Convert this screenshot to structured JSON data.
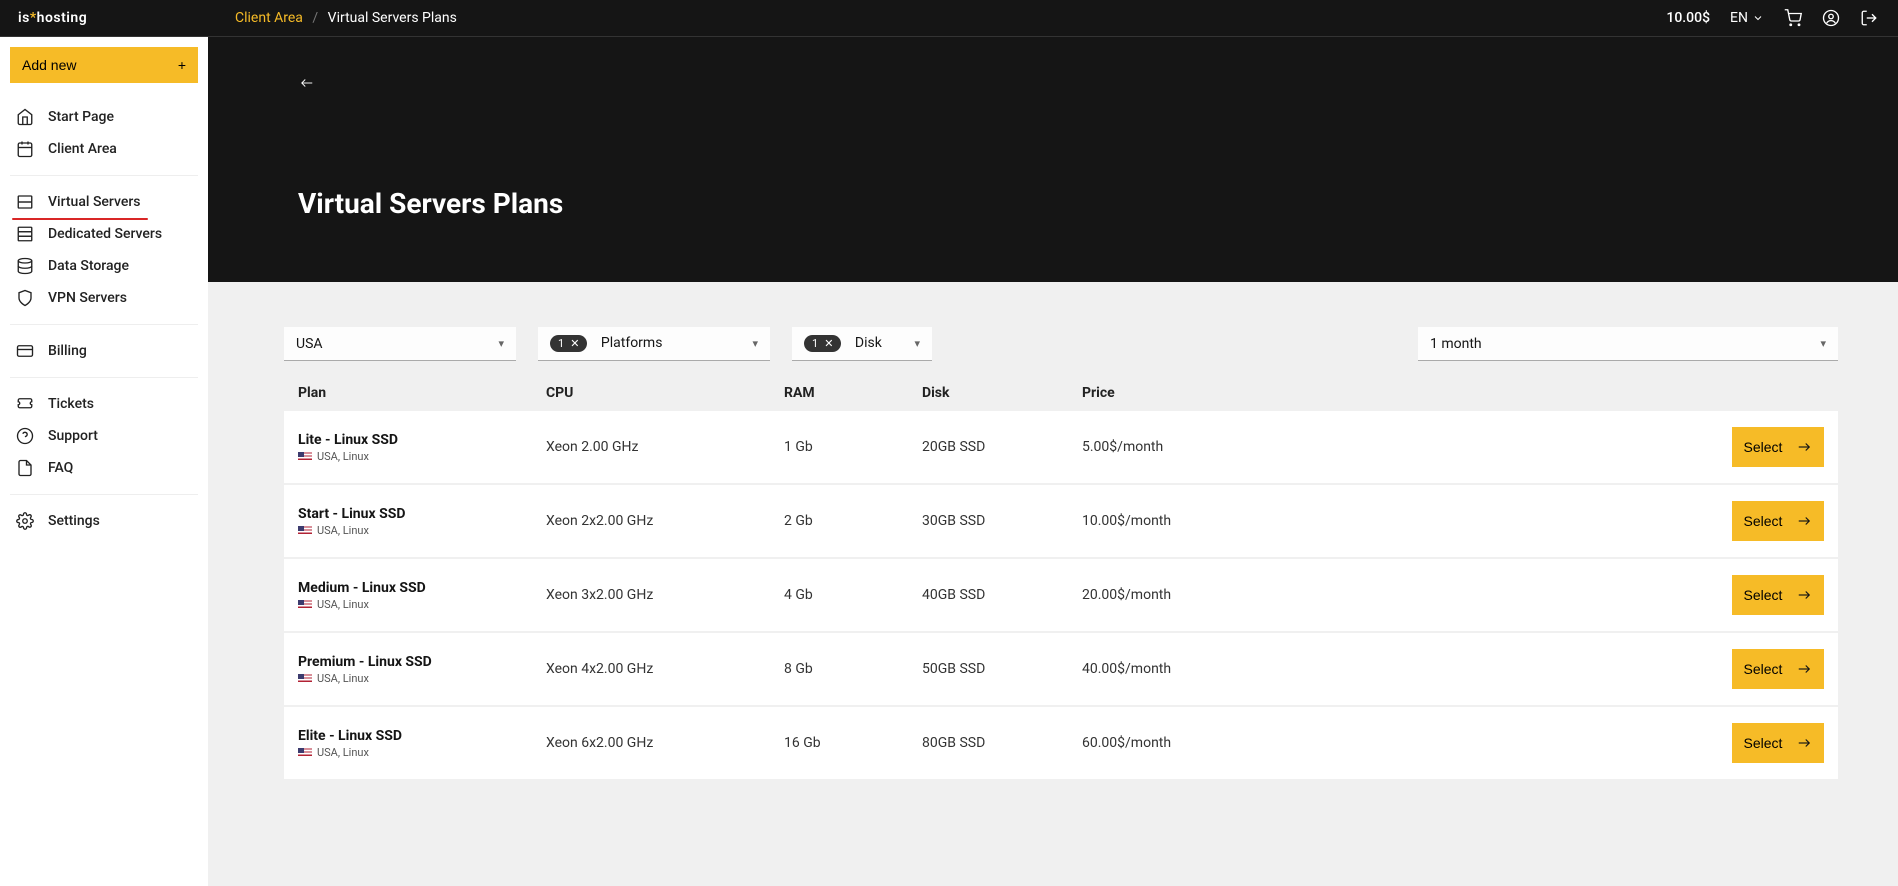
{
  "brand": {
    "pre": "is",
    "star": "*",
    "post": "hosting"
  },
  "breadcrumb": {
    "root": "Client Area",
    "sep": "/",
    "page": "Virtual Servers Plans"
  },
  "header": {
    "balance": "10.00$",
    "lang": "EN"
  },
  "sidebar": {
    "add_label": "Add new",
    "nav1": [
      {
        "label": "Start Page"
      },
      {
        "label": "Client Area"
      }
    ],
    "nav2": [
      {
        "label": "Virtual Servers",
        "active": true
      },
      {
        "label": "Dedicated Servers"
      },
      {
        "label": "Data Storage"
      },
      {
        "label": "VPN Servers"
      }
    ],
    "nav3": [
      {
        "label": "Billing"
      }
    ],
    "nav4": [
      {
        "label": "Tickets"
      },
      {
        "label": "Support"
      },
      {
        "label": "FAQ"
      }
    ],
    "nav5": [
      {
        "label": "Settings"
      }
    ]
  },
  "page": {
    "title": "Virtual Servers Plans"
  },
  "filters": {
    "country": "USA",
    "platforms_chip": "1",
    "platforms_label": "Platforms",
    "disk_chip": "1",
    "disk_label": "Disk",
    "billing": "1 month"
  },
  "table": {
    "headers": {
      "plan": "Plan",
      "cpu": "CPU",
      "ram": "RAM",
      "disk": "Disk",
      "price": "Price"
    },
    "select_label": "Select",
    "rows": [
      {
        "name": "Lite - Linux SSD",
        "sub": "USA, Linux",
        "cpu": "Xeon 2.00 GHz",
        "ram": "1 Gb",
        "disk": "20GB SSD",
        "price": "5.00$/month"
      },
      {
        "name": "Start - Linux SSD",
        "sub": "USA, Linux",
        "cpu": "Xeon 2x2.00 GHz",
        "ram": "2 Gb",
        "disk": "30GB SSD",
        "price": "10.00$/month"
      },
      {
        "name": "Medium - Linux SSD",
        "sub": "USA, Linux",
        "cpu": "Xeon 3x2.00 GHz",
        "ram": "4 Gb",
        "disk": "40GB SSD",
        "price": "20.00$/month"
      },
      {
        "name": "Premium - Linux SSD",
        "sub": "USA, Linux",
        "cpu": "Xeon 4x2.00 GHz",
        "ram": "8 Gb",
        "disk": "50GB SSD",
        "price": "40.00$/month"
      },
      {
        "name": "Elite - Linux SSD",
        "sub": "USA, Linux",
        "cpu": "Xeon 6x2.00 GHz",
        "ram": "16 Gb",
        "disk": "80GB SSD",
        "price": "60.00$/month"
      }
    ]
  }
}
